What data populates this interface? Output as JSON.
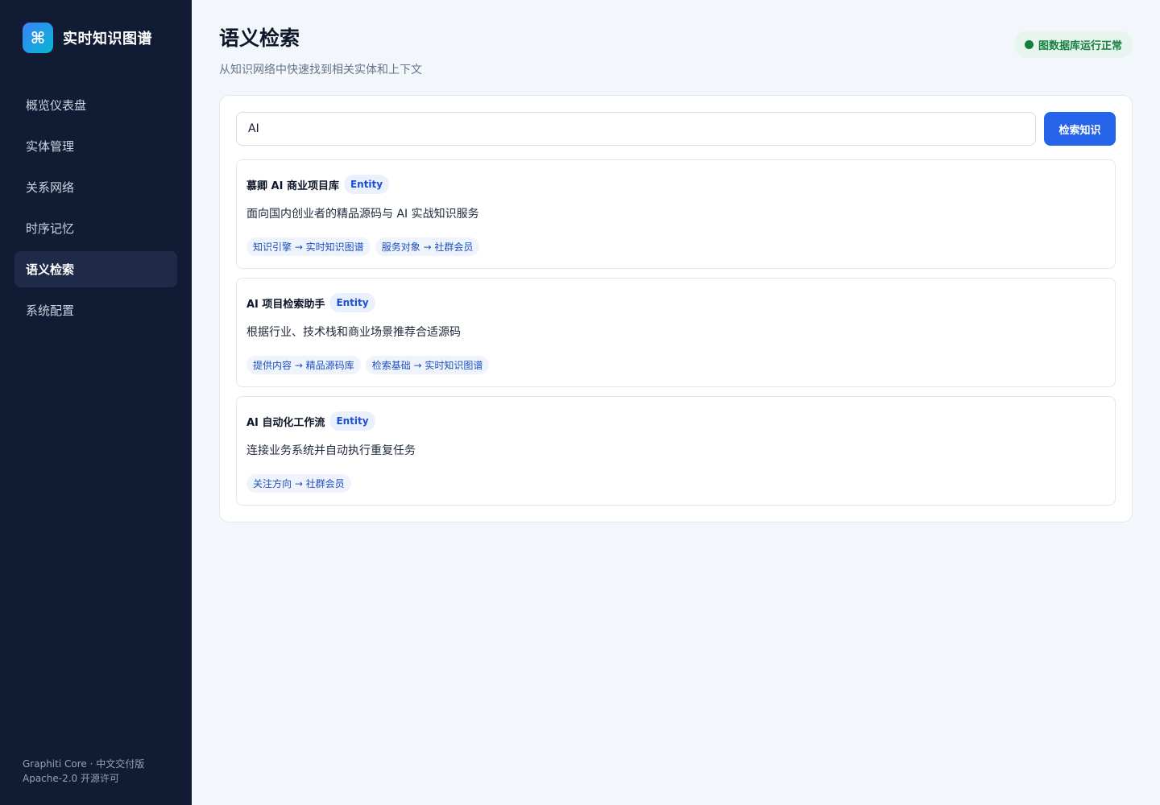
{
  "brand": {
    "logo_glyph": "⌘",
    "title": "实时知识图谱"
  },
  "sidebar": {
    "items": [
      {
        "label": "概览仪表盘"
      },
      {
        "label": "实体管理"
      },
      {
        "label": "关系网络"
      },
      {
        "label": "时序记忆"
      },
      {
        "label": "语义检索",
        "active": true
      },
      {
        "label": "系统配置"
      }
    ],
    "footer_line1": "Graphiti Core · 中文交付版",
    "footer_line2": "Apache-2.0 开源许可"
  },
  "header": {
    "title": "语义检索",
    "subtitle": "从知识网络中快速找到相关实体和上下文",
    "status": "图数据库运行正常"
  },
  "search": {
    "value": "AI",
    "button_label": "检索知识"
  },
  "results": [
    {
      "title": "慕卿 AI 商业项目库",
      "badge": "Entity",
      "description": "面向国内创业者的精品源码与 AI 实战知识服务",
      "tags": [
        "知识引擎 → 实时知识图谱",
        "服务对象 → 社群会员"
      ]
    },
    {
      "title": "AI 项目检索助手",
      "badge": "Entity",
      "description": "根据行业、技术栈和商业场景推荐合适源码",
      "tags": [
        "提供内容 → 精品源码库",
        "检索基础 → 实时知识图谱"
      ]
    },
    {
      "title": "AI 自动化工作流",
      "badge": "Entity",
      "description": "连接业务系统并自动执行重复任务",
      "tags": [
        "关注方向 → 社群会员"
      ]
    }
  ],
  "colors": {
    "sidebar_bg": "#111b33",
    "accent": "#2563eb",
    "status_green": "#15803d"
  }
}
